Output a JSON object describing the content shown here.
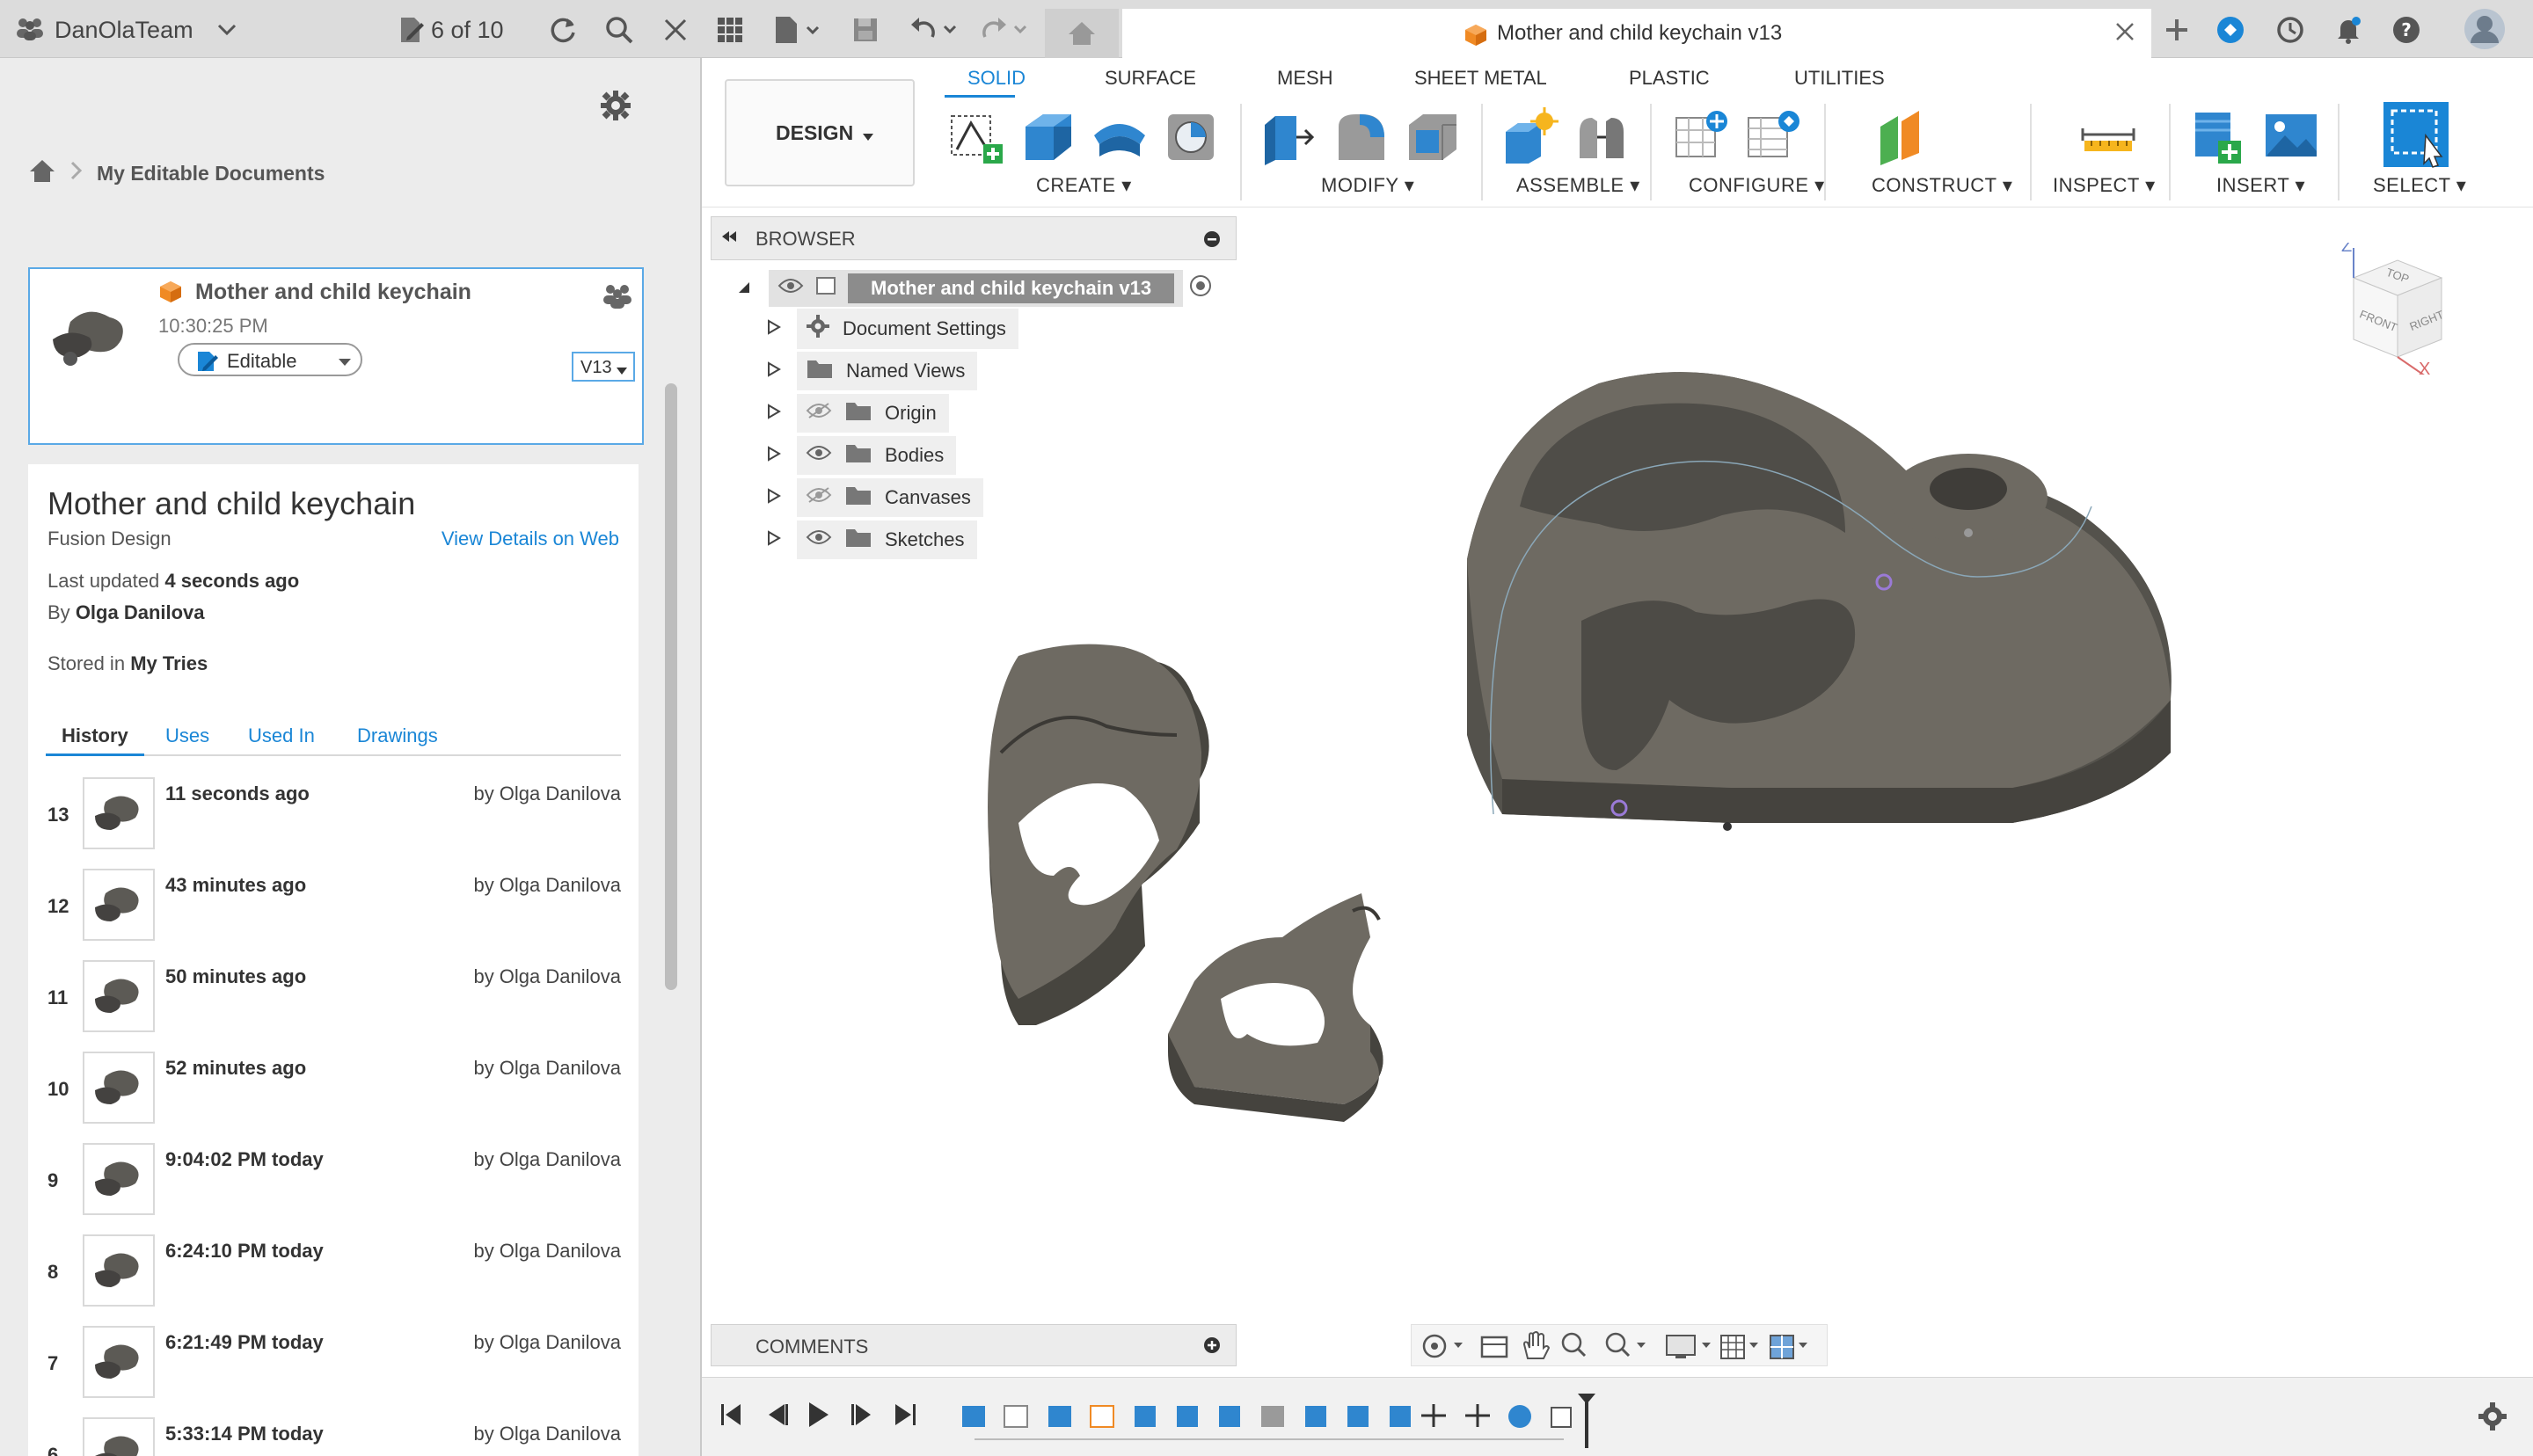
{
  "top_bar": {
    "team_name": "DanOlaTeam",
    "doc_counter": "6 of 10"
  },
  "document_tab": {
    "title": "Mother and child keychain v13"
  },
  "left_panel": {
    "breadcrumb": "My Editable Documents",
    "card": {
      "name": "Mother and child keychain",
      "time": "10:30:25 PM",
      "state": "Editable",
      "version": "V13"
    },
    "info": {
      "title": "Mother and child keychain",
      "type": "Fusion Design",
      "web_link": "View Details on Web",
      "last_updated_label": "Last updated",
      "last_updated_value": "4 seconds ago",
      "by_label": "By",
      "by_value": "Olga Danilova",
      "stored_label": "Stored in",
      "stored_value": "My Tries"
    },
    "tabs": [
      "History",
      "Uses",
      "Used In",
      "Drawings"
    ],
    "history": [
      {
        "num": "13",
        "time": "11 seconds ago",
        "by": "by Olga Danilova"
      },
      {
        "num": "12",
        "time": "43 minutes ago",
        "by": "by Olga Danilova"
      },
      {
        "num": "11",
        "time": "50 minutes ago",
        "by": "by Olga Danilova"
      },
      {
        "num": "10",
        "time": "52 minutes ago",
        "by": "by Olga Danilova"
      },
      {
        "num": "9",
        "time": "9:04:02 PM today",
        "by": "by Olga Danilova"
      },
      {
        "num": "8",
        "time": "6:24:10 PM today",
        "by": "by Olga Danilova"
      },
      {
        "num": "7",
        "time": "6:21:49 PM today",
        "by": "by Olga Danilova"
      },
      {
        "num": "6",
        "time": "5:33:14 PM today",
        "by": "by Olga Danilova"
      }
    ]
  },
  "toolbar": {
    "workspace": "DESIGN",
    "tabs": [
      "SOLID",
      "SURFACE",
      "MESH",
      "SHEET METAL",
      "PLASTIC",
      "UTILITIES"
    ],
    "groups": [
      "CREATE",
      "MODIFY",
      "ASSEMBLE",
      "CONFIGURE",
      "CONSTRUCT",
      "INSPECT",
      "INSERT",
      "SELECT"
    ]
  },
  "browser": {
    "header": "BROWSER",
    "root": "Mother and child keychain v13",
    "items": [
      "Document Settings",
      "Named Views",
      "Origin",
      "Bodies",
      "Canvases",
      "Sketches"
    ]
  },
  "viewcube": {
    "faces": [
      "TOP",
      "FRONT",
      "RIGHT"
    ],
    "axes": [
      "Z",
      "X"
    ]
  },
  "comments": {
    "label": "COMMENTS"
  },
  "colors": {
    "accent": "#1a86d6",
    "model": "#6e6a62",
    "card_border": "#5aa9e6"
  }
}
